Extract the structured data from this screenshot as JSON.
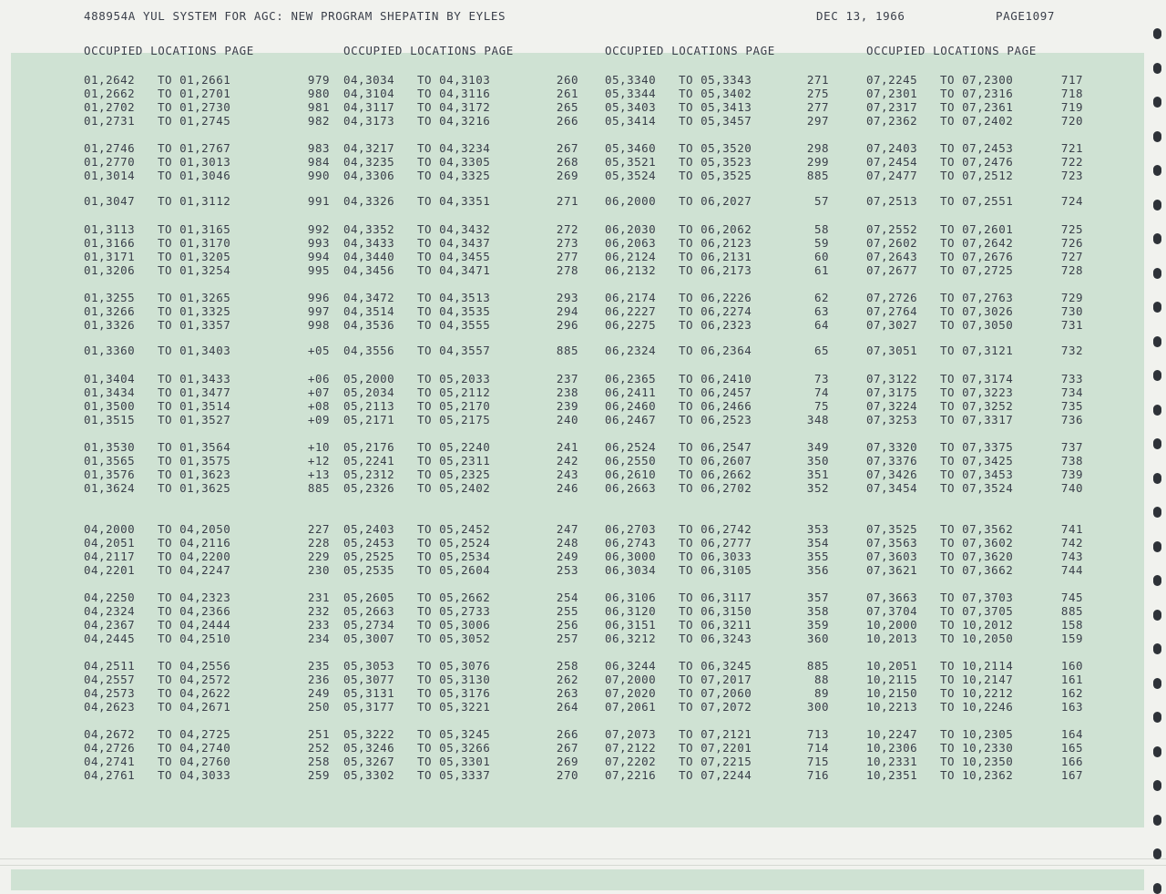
{
  "header": {
    "title": "488954A YUL SYSTEM FOR AGC: NEW PROGRAM SHEPATIN BY EYLES",
    "date": "DEC 13, 1966",
    "page": "PAGE1097"
  },
  "column_header": "OCCUPIED LOCATIONS PAGE",
  "columns": [
    {
      "groups": [
        [
          [
            "01,2642",
            "TO 01,2661",
            "979"
          ],
          [
            "01,2662",
            "TO 01,2701",
            "980"
          ],
          [
            "01,2702",
            "TO 01,2730",
            "981"
          ],
          [
            "01,2731",
            "TO 01,2745",
            "982"
          ]
        ],
        [
          [
            "01,2746",
            "TO 01,2767",
            "983"
          ],
          [
            "01,2770",
            "TO 01,3013",
            "984"
          ],
          [
            "01,3014",
            "TO 01,3046",
            "990"
          ]
        ],
        [
          [
            "01,3047",
            "TO 01,3112",
            "991"
          ]
        ],
        [
          [
            "01,3113",
            "TO 01,3165",
            "992"
          ],
          [
            "01,3166",
            "TO 01,3170",
            "993"
          ],
          [
            "01,3171",
            "TO 01,3205",
            "994"
          ],
          [
            "01,3206",
            "TO 01,3254",
            "995"
          ]
        ],
        [
          [
            "01,3255",
            "TO 01,3265",
            "996"
          ],
          [
            "01,3266",
            "TO 01,3325",
            "997"
          ],
          [
            "01,3326",
            "TO 01,3357",
            "998"
          ]
        ],
        [
          [
            "01,3360",
            "TO 01,3403",
            "+05"
          ]
        ],
        [
          [
            "01,3404",
            "TO 01,3433",
            "+06"
          ],
          [
            "01,3434",
            "TO 01,3477",
            "+07"
          ],
          [
            "01,3500",
            "TO 01,3514",
            "+08"
          ],
          [
            "01,3515",
            "TO 01,3527",
            "+09"
          ]
        ],
        [
          [
            "01,3530",
            "TO 01,3564",
            "+10"
          ],
          [
            "01,3565",
            "TO 01,3575",
            "+12"
          ],
          [
            "01,3576",
            "TO 01,3623",
            "+13"
          ],
          [
            "01,3624",
            "TO 01,3625",
            "885"
          ]
        ],
        [
          [
            "04,2000",
            "TO 04,2050",
            "227"
          ],
          [
            "04,2051",
            "TO 04,2116",
            "228"
          ],
          [
            "04,2117",
            "TO 04,2200",
            "229"
          ],
          [
            "04,2201",
            "TO 04,2247",
            "230"
          ]
        ],
        [
          [
            "04,2250",
            "TO 04,2323",
            "231"
          ],
          [
            "04,2324",
            "TO 04,2366",
            "232"
          ],
          [
            "04,2367",
            "TO 04,2444",
            "233"
          ],
          [
            "04,2445",
            "TO 04,2510",
            "234"
          ]
        ],
        [
          [
            "04,2511",
            "TO 04,2556",
            "235"
          ],
          [
            "04,2557",
            "TO 04,2572",
            "236"
          ],
          [
            "04,2573",
            "TO 04,2622",
            "249"
          ],
          [
            "04,2623",
            "TO 04,2671",
            "250"
          ]
        ],
        [
          [
            "04,2672",
            "TO 04,2725",
            "251"
          ],
          [
            "04,2726",
            "TO 04,2740",
            "252"
          ],
          [
            "04,2741",
            "TO 04,2760",
            "258"
          ],
          [
            "04,2761",
            "TO 04,3033",
            "259"
          ]
        ]
      ]
    },
    {
      "groups": [
        [
          [
            "04,3034",
            "TO 04,3103",
            "260"
          ],
          [
            "04,3104",
            "TO 04,3116",
            "261"
          ],
          [
            "04,3117",
            "TO 04,3172",
            "265"
          ],
          [
            "04,3173",
            "TO 04,3216",
            "266"
          ]
        ],
        [
          [
            "04,3217",
            "TO 04,3234",
            "267"
          ],
          [
            "04,3235",
            "TO 04,3305",
            "268"
          ],
          [
            "04,3306",
            "TO 04,3325",
            "269"
          ]
        ],
        [
          [
            "04,3326",
            "TO 04,3351",
            "271"
          ]
        ],
        [
          [
            "04,3352",
            "TO 04,3432",
            "272"
          ],
          [
            "04,3433",
            "TO 04,3437",
            "273"
          ],
          [
            "04,3440",
            "TO 04,3455",
            "277"
          ],
          [
            "04,3456",
            "TO 04,3471",
            "278"
          ]
        ],
        [
          [
            "04,3472",
            "TO 04,3513",
            "293"
          ],
          [
            "04,3514",
            "TO 04,3535",
            "294"
          ],
          [
            "04,3536",
            "TO 04,3555",
            "296"
          ]
        ],
        [
          [
            "04,3556",
            "TO 04,3557",
            "885"
          ]
        ],
        [
          [
            "05,2000",
            "TO 05,2033",
            "237"
          ],
          [
            "05,2034",
            "TO 05,2112",
            "238"
          ],
          [
            "05,2113",
            "TO 05,2170",
            "239"
          ],
          [
            "05,2171",
            "TO 05,2175",
            "240"
          ]
        ],
        [
          [
            "05,2176",
            "TO 05,2240",
            "241"
          ],
          [
            "05,2241",
            "TO 05,2311",
            "242"
          ],
          [
            "05,2312",
            "TO 05,2325",
            "243"
          ],
          [
            "05,2326",
            "TO 05,2402",
            "246"
          ]
        ],
        [
          [
            "05,2403",
            "TO 05,2452",
            "247"
          ],
          [
            "05,2453",
            "TO 05,2524",
            "248"
          ],
          [
            "05,2525",
            "TO 05,2534",
            "249"
          ],
          [
            "05,2535",
            "TO 05,2604",
            "253"
          ]
        ],
        [
          [
            "05,2605",
            "TO 05,2662",
            "254"
          ],
          [
            "05,2663",
            "TO 05,2733",
            "255"
          ],
          [
            "05,2734",
            "TO 05,3006",
            "256"
          ],
          [
            "05,3007",
            "TO 05,3052",
            "257"
          ]
        ],
        [
          [
            "05,3053",
            "TO 05,3076",
            "258"
          ],
          [
            "05,3077",
            "TO 05,3130",
            "262"
          ],
          [
            "05,3131",
            "TO 05,3176",
            "263"
          ],
          [
            "05,3177",
            "TO 05,3221",
            "264"
          ]
        ],
        [
          [
            "05,3222",
            "TO 05,3245",
            "266"
          ],
          [
            "05,3246",
            "TO 05,3266",
            "267"
          ],
          [
            "05,3267",
            "TO 05,3301",
            "269"
          ],
          [
            "05,3302",
            "TO 05,3337",
            "270"
          ]
        ]
      ]
    },
    {
      "groups": [
        [
          [
            "05,3340",
            "TO 05,3343",
            "271"
          ],
          [
            "05,3344",
            "TO 05,3402",
            "275"
          ],
          [
            "05,3403",
            "TO 05,3413",
            "277"
          ],
          [
            "05,3414",
            "TO 05,3457",
            "297"
          ]
        ],
        [
          [
            "05,3460",
            "TO 05,3520",
            "298"
          ],
          [
            "05,3521",
            "TO 05,3523",
            "299"
          ],
          [
            "05,3524",
            "TO 05,3525",
            "885"
          ]
        ],
        [
          [
            "06,2000",
            "TO 06,2027",
            "57"
          ]
        ],
        [
          [
            "06,2030",
            "TO 06,2062",
            "58"
          ],
          [
            "06,2063",
            "TO 06,2123",
            "59"
          ],
          [
            "06,2124",
            "TO 06,2131",
            "60"
          ],
          [
            "06,2132",
            "TO 06,2173",
            "61"
          ]
        ],
        [
          [
            "06,2174",
            "TO 06,2226",
            "62"
          ],
          [
            "06,2227",
            "TO 06,2274",
            "63"
          ],
          [
            "06,2275",
            "TO 06,2323",
            "64"
          ]
        ],
        [
          [
            "06,2324",
            "TO 06,2364",
            "65"
          ]
        ],
        [
          [
            "06,2365",
            "TO 06,2410",
            "73"
          ],
          [
            "06,2411",
            "TO 06,2457",
            "74"
          ],
          [
            "06,2460",
            "TO 06,2466",
            "75"
          ],
          [
            "06,2467",
            "TO 06,2523",
            "348"
          ]
        ],
        [
          [
            "06,2524",
            "TO 06,2547",
            "349"
          ],
          [
            "06,2550",
            "TO 06,2607",
            "350"
          ],
          [
            "06,2610",
            "TO 06,2662",
            "351"
          ],
          [
            "06,2663",
            "TO 06,2702",
            "352"
          ]
        ],
        [
          [
            "06,2703",
            "TO 06,2742",
            "353"
          ],
          [
            "06,2743",
            "TO 06,2777",
            "354"
          ],
          [
            "06,3000",
            "TO 06,3033",
            "355"
          ],
          [
            "06,3034",
            "TO 06,3105",
            "356"
          ]
        ],
        [
          [
            "06,3106",
            "TO 06,3117",
            "357"
          ],
          [
            "06,3120",
            "TO 06,3150",
            "358"
          ],
          [
            "06,3151",
            "TO 06,3211",
            "359"
          ],
          [
            "06,3212",
            "TO 06,3243",
            "360"
          ]
        ],
        [
          [
            "06,3244",
            "TO 06,3245",
            "885"
          ],
          [
            "07,2000",
            "TO 07,2017",
            "88"
          ],
          [
            "07,2020",
            "TO 07,2060",
            "89"
          ],
          [
            "07,2061",
            "TO 07,2072",
            "300"
          ]
        ],
        [
          [
            "07,2073",
            "TO 07,2121",
            "713"
          ],
          [
            "07,2122",
            "TO 07,2201",
            "714"
          ],
          [
            "07,2202",
            "TO 07,2215",
            "715"
          ],
          [
            "07,2216",
            "TO 07,2244",
            "716"
          ]
        ]
      ]
    },
    {
      "groups": [
        [
          [
            "07,2245",
            "TO 07,2300",
            "717"
          ],
          [
            "07,2301",
            "TO 07,2316",
            "718"
          ],
          [
            "07,2317",
            "TO 07,2361",
            "719"
          ],
          [
            "07,2362",
            "TO 07,2402",
            "720"
          ]
        ],
        [
          [
            "07,2403",
            "TO 07,2453",
            "721"
          ],
          [
            "07,2454",
            "TO 07,2476",
            "722"
          ],
          [
            "07,2477",
            "TO 07,2512",
            "723"
          ]
        ],
        [
          [
            "07,2513",
            "TO 07,2551",
            "724"
          ]
        ],
        [
          [
            "07,2552",
            "TO 07,2601",
            "725"
          ],
          [
            "07,2602",
            "TO 07,2642",
            "726"
          ],
          [
            "07,2643",
            "TO 07,2676",
            "727"
          ],
          [
            "07,2677",
            "TO 07,2725",
            "728"
          ]
        ],
        [
          [
            "07,2726",
            "TO 07,2763",
            "729"
          ],
          [
            "07,2764",
            "TO 07,3026",
            "730"
          ],
          [
            "07,3027",
            "TO 07,3050",
            "731"
          ]
        ],
        [
          [
            "07,3051",
            "TO 07,3121",
            "732"
          ]
        ],
        [
          [
            "07,3122",
            "TO 07,3174",
            "733"
          ],
          [
            "07,3175",
            "TO 07,3223",
            "734"
          ],
          [
            "07,3224",
            "TO 07,3252",
            "735"
          ],
          [
            "07,3253",
            "TO 07,3317",
            "736"
          ]
        ],
        [
          [
            "07,3320",
            "TO 07,3375",
            "737"
          ],
          [
            "07,3376",
            "TO 07,3425",
            "738"
          ],
          [
            "07,3426",
            "TO 07,3453",
            "739"
          ],
          [
            "07,3454",
            "TO 07,3524",
            "740"
          ]
        ],
        [
          [
            "07,3525",
            "TO 07,3562",
            "741"
          ],
          [
            "07,3563",
            "TO 07,3602",
            "742"
          ],
          [
            "07,3603",
            "TO 07,3620",
            "743"
          ],
          [
            "07,3621",
            "TO 07,3662",
            "744"
          ]
        ],
        [
          [
            "07,3663",
            "TO 07,3703",
            "745"
          ],
          [
            "07,3704",
            "TO 07,3705",
            "885"
          ],
          [
            "10,2000",
            "TO 10,2012",
            "158"
          ],
          [
            "10,2013",
            "TO 10,2050",
            "159"
          ]
        ],
        [
          [
            "10,2051",
            "TO 10,2114",
            "160"
          ],
          [
            "10,2115",
            "TO 10,2147",
            "161"
          ],
          [
            "10,2150",
            "TO 10,2212",
            "162"
          ],
          [
            "10,2213",
            "TO 10,2246",
            "163"
          ]
        ],
        [
          [
            "10,2247",
            "TO 10,2305",
            "164"
          ],
          [
            "10,2306",
            "TO 10,2330",
            "165"
          ],
          [
            "10,2331",
            "TO 10,2350",
            "166"
          ],
          [
            "10,2351",
            "TO 10,2362",
            "167"
          ]
        ]
      ]
    }
  ],
  "colors": {
    "paper": "#f1f2ee",
    "band": "#cfe2d3",
    "ink": "#3a3f4a"
  }
}
